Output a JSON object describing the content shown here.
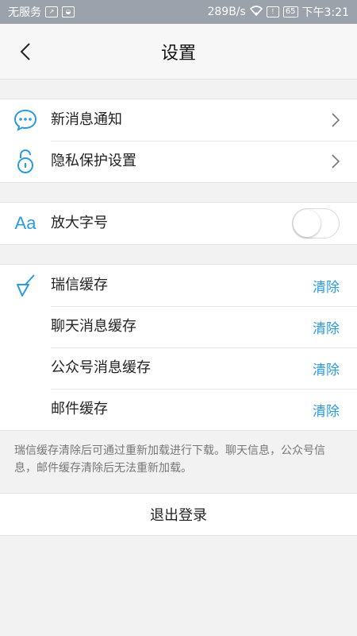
{
  "status_bar": {
    "carrier": "无服务",
    "speed": "289B/s",
    "battery": "65",
    "time": "下午3:21"
  },
  "header": {
    "title": "设置"
  },
  "settings": {
    "notifications": "新消息通知",
    "privacy": "隐私保护设置",
    "font_size": "放大字号",
    "font_size_toggle_on": false
  },
  "cache": {
    "items": [
      {
        "label": "瑞信缓存",
        "action": "清除"
      },
      {
        "label": "聊天消息缓存",
        "action": "清除"
      },
      {
        "label": "公众号消息缓存",
        "action": "清除"
      },
      {
        "label": "邮件缓存",
        "action": "清除"
      }
    ],
    "note": "瑞信缓存清除后可通过重新加载进行下载。聊天信息，公众号信息，邮件缓存清除后无法重新加载。"
  },
  "logout": "退出登录",
  "colors": {
    "accent": "#2a9be0",
    "status_bar": "#9aa2ab"
  }
}
